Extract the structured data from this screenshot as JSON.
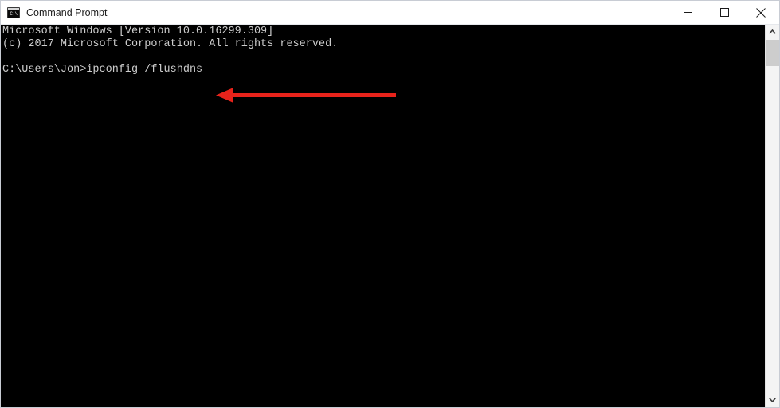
{
  "window": {
    "title": "Command Prompt",
    "app_icon_name": "command-prompt-icon",
    "app_icon_glyph": "C:\\",
    "background_color": "#000000",
    "titlebar_color": "#ffffff"
  },
  "window_controls": {
    "minimize_label": "Minimize",
    "maximize_label": "Maximize",
    "close_label": "Close"
  },
  "console": {
    "text_color": "#cccccc",
    "lines": [
      "Microsoft Windows [Version 10.0.16299.309]",
      "(c) 2017 Microsoft Corporation. All rights reserved.",
      "",
      "C:\\Users\\Jon>ipconfig /flushdns"
    ],
    "content": "Microsoft Windows [Version 10.0.16299.309]\n(c) 2017 Microsoft Corporation. All rights reserved.\n\nC:\\Users\\Jon>ipconfig /flushdns",
    "prompt": "C:\\Users\\Jon>",
    "command": "ipconfig /flushdns",
    "version_string": "10.0.16299.309",
    "copyright_year": "2017"
  },
  "annotation": {
    "type": "arrow",
    "direction": "left",
    "color": "#e8231b",
    "points_at": "ipconfig /flushdns"
  },
  "scrollbar": {
    "up_arrow_name": "scroll-up-arrow",
    "down_arrow_name": "scroll-down-arrow",
    "thumb_color": "#cdcdcd",
    "track_color": "#f4f4f4"
  }
}
